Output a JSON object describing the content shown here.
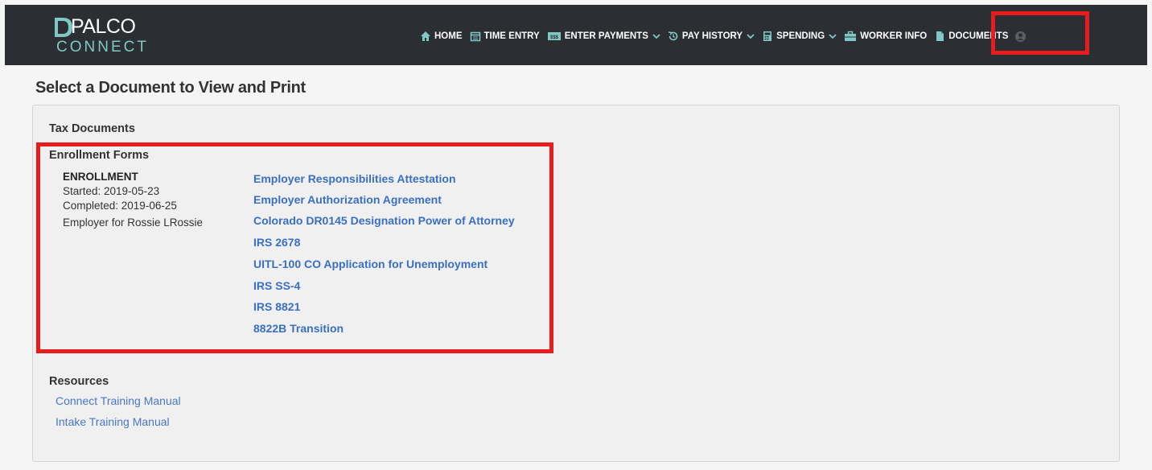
{
  "header": {
    "logo_text": "PALCO",
    "logo_sub": "CONNECT",
    "brand_color": "#2b2f33",
    "accent_color": "#7fc8c4",
    "highlight_color": "#e81c1c"
  },
  "nav": {
    "items": [
      {
        "label": "HOME",
        "icon": "home-icon"
      },
      {
        "label": "TIME ENTRY",
        "icon": "calendar-icon"
      },
      {
        "label": "ENTER PAYMENTS",
        "icon": "money-icon",
        "dropdown": true
      },
      {
        "label": "PAY HISTORY",
        "icon": "history-icon",
        "dropdown": true
      },
      {
        "label": "SPENDING",
        "icon": "calculator-icon",
        "dropdown": true
      },
      {
        "label": "WORKER INFO",
        "icon": "briefcase-icon"
      },
      {
        "label": "DOCUMENTS",
        "icon": "document-icon",
        "active": true
      }
    ],
    "user_icon": "user-icon"
  },
  "page": {
    "title": "Select a Document to View and Print"
  },
  "sections": {
    "tax": "Tax Documents",
    "enrollment_forms": "Enrollment Forms",
    "resources": "Resources"
  },
  "enrollment": {
    "title": "ENROLLMENT",
    "started": "Started: 2019-05-23",
    "completed": "Completed: 2019-06-25",
    "employer": "Employer for Rossie LRossie"
  },
  "documents": [
    "Employer Responsibilities Attestation",
    "Employer Authorization Agreement",
    "Colorado DR0145 Designation Power of Attorney",
    "IRS 2678",
    "UITL-100 CO Application for Unemployment",
    "IRS SS-4",
    "IRS 8821",
    "8822B Transition"
  ],
  "resources": [
    "Connect Training Manual",
    "Intake Training Manual"
  ]
}
